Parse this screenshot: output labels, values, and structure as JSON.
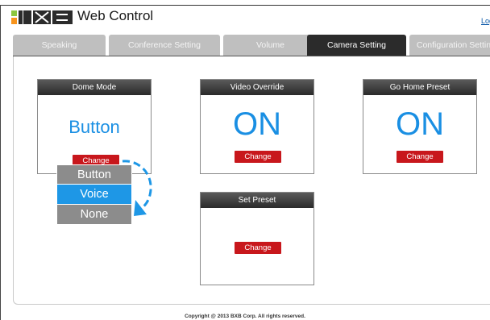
{
  "header": {
    "logo_text": "BXB",
    "title": "Web Control",
    "logout_label": "Log"
  },
  "tabs": [
    {
      "label": "Speaking",
      "active": false
    },
    {
      "label": "Conference Setting",
      "active": false
    },
    {
      "label": "Volume",
      "active": false
    },
    {
      "label": "Camera Setting",
      "active": true
    },
    {
      "label": "Configuration Settin",
      "active": false
    }
  ],
  "cards": {
    "dome_mode": {
      "title": "Dome Mode",
      "value": "Button",
      "button_label": "Change"
    },
    "video_override": {
      "title": "Video Override",
      "value": "ON",
      "button_label": "Change"
    },
    "go_home_preset": {
      "title": "Go Home Preset",
      "value": "ON",
      "button_label": "Change"
    },
    "set_preset": {
      "title": "Set Preset",
      "button_label": "Change"
    }
  },
  "dome_mode_dropdown": {
    "options": [
      "Button",
      "Voice",
      "None"
    ],
    "selected": "Voice"
  },
  "footer": {
    "copyright": "Copyright @ 2013 BXB Corp. All rights reserved."
  },
  "colors": {
    "accent_blue": "#1e97e6",
    "change_button_red": "#c8171c",
    "active_tab": "#2b2b2b",
    "inactive_tab": "#bfbfbf"
  }
}
